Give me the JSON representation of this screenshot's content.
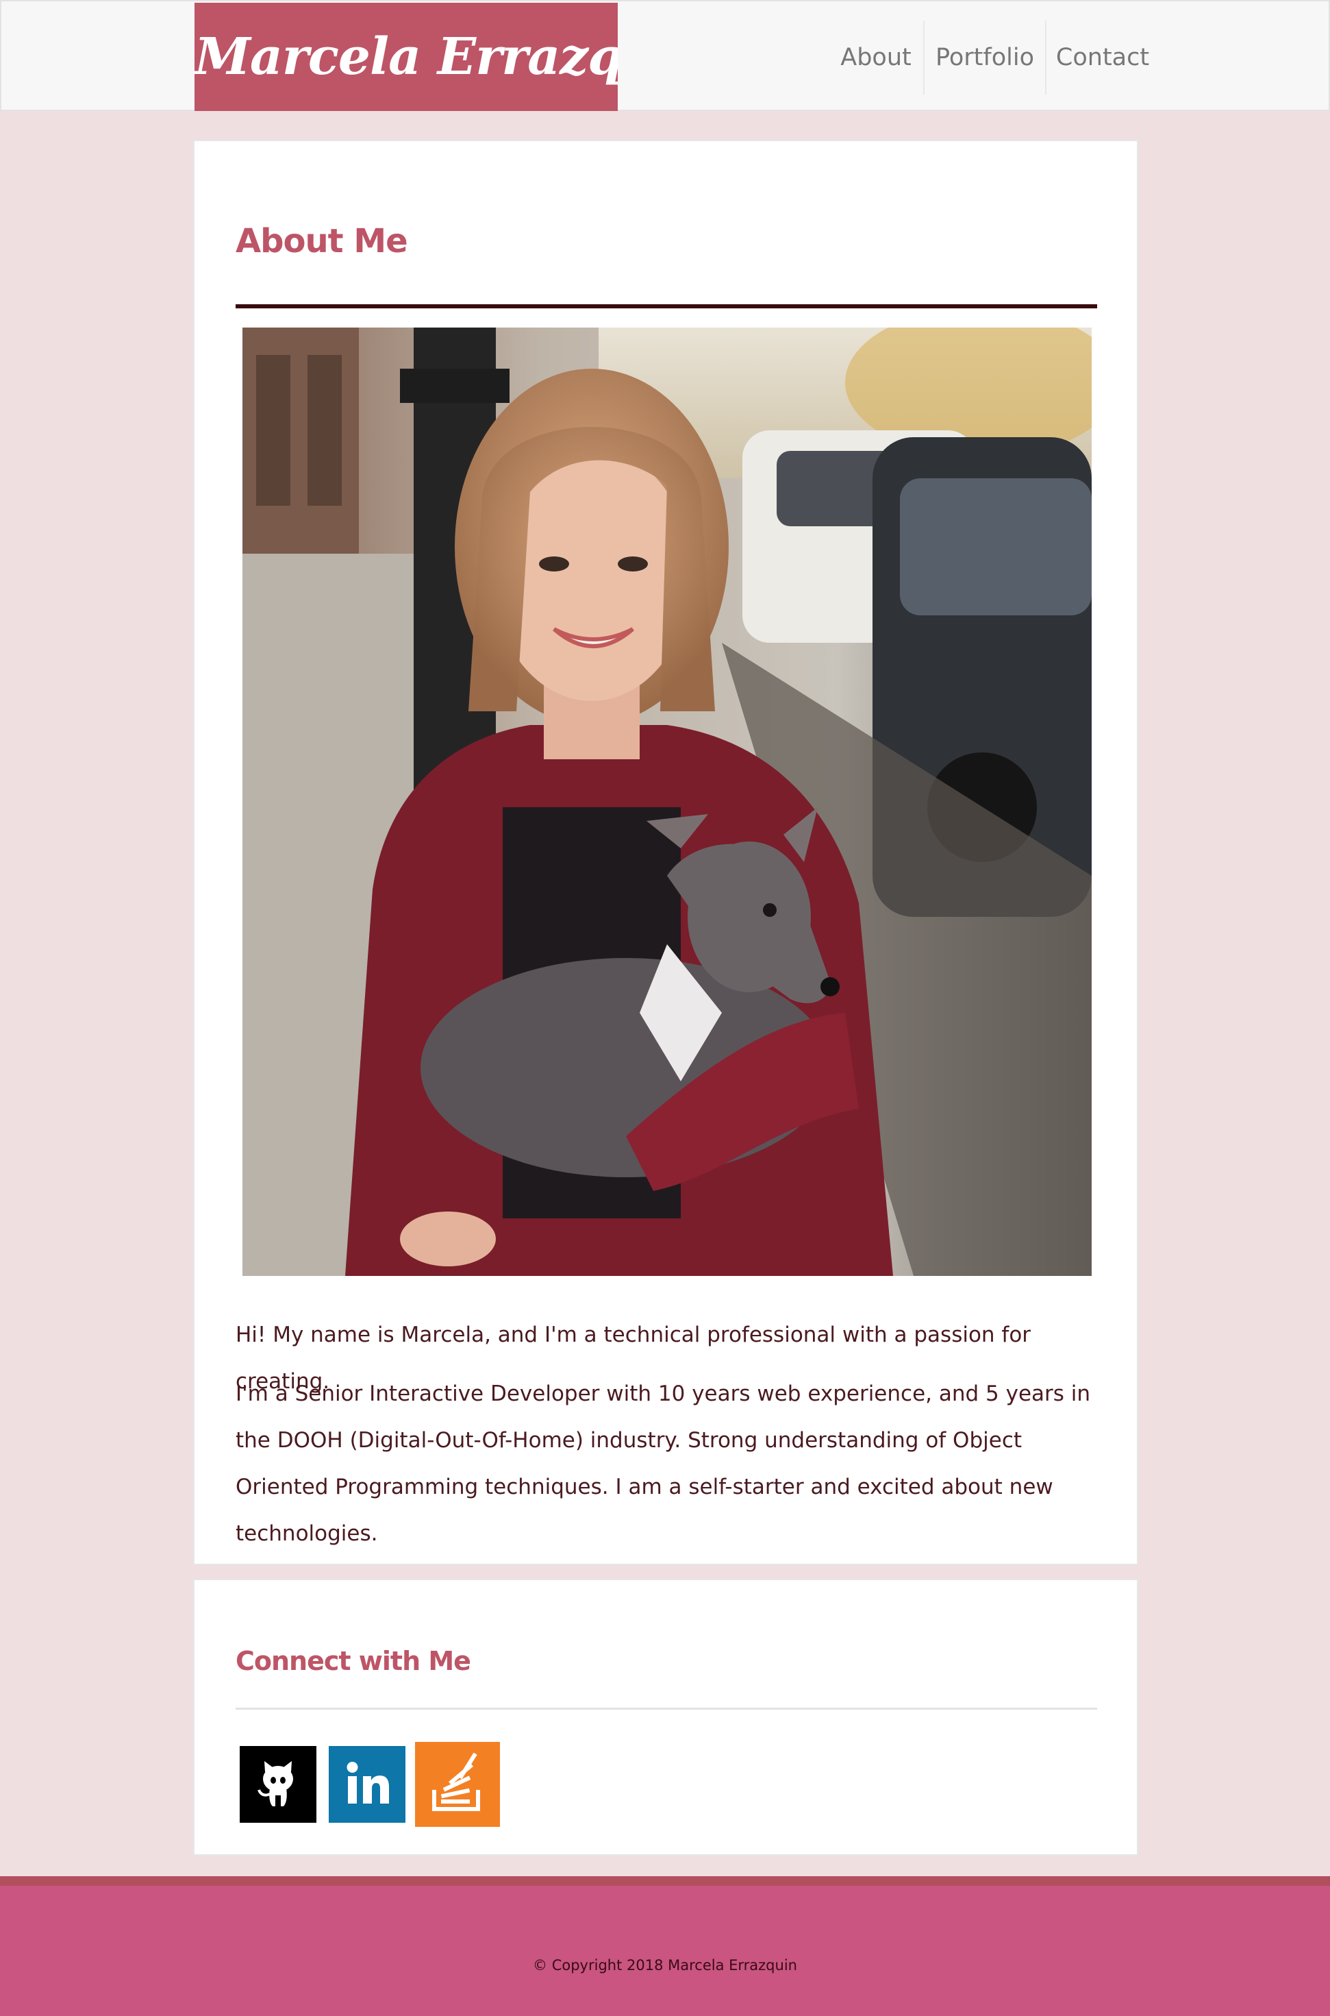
{
  "header": {
    "brand": "Marcela Errazquin",
    "nav": [
      "About",
      "Portfolio",
      "Contact"
    ]
  },
  "about": {
    "title": "About Me",
    "intro": "Hi! My name is Marcela, and I'm a technical professional with a passion for creating.",
    "bio": "I'm a Senior Interactive Developer with 10 years web experience, and 5 years in the DOOH (Digital-Out-Of-Home) industry. Strong understanding of Object Oriented Programming techniques. I am a self-starter and excited about new technologies."
  },
  "connect": {
    "title": "Connect with Me",
    "links": [
      {
        "name": "GitHub",
        "icon": "github-icon",
        "color": "#000000"
      },
      {
        "name": "LinkedIn",
        "icon": "linkedin-icon",
        "color": "#0e76a8"
      },
      {
        "name": "Stack Overflow",
        "icon": "stackoverflow-icon",
        "color": "#f48024"
      }
    ]
  },
  "footer": {
    "copyright": "© Copyright 2018 Marcela Errazquin"
  },
  "colors": {
    "accent": "#bd5566",
    "page_background": "#f0dfe1",
    "footer": "#c95580",
    "text": "#4a1a1f"
  }
}
